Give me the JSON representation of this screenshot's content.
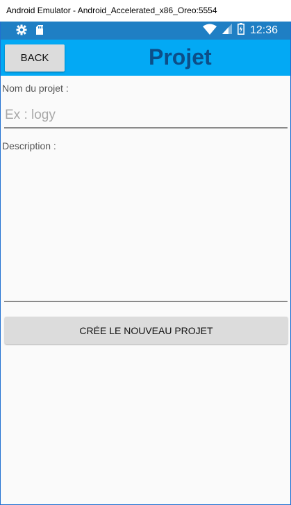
{
  "window": {
    "title": "Android Emulator - Android_Accelerated_x86_Oreo:5554"
  },
  "statusbar": {
    "time": "12:36",
    "icons_left": [
      "gear-icon",
      "sd-card-icon"
    ],
    "icons_right": [
      "wifi-icon",
      "cell-signal-icon",
      "battery-icon"
    ],
    "color": "#1f7fc4"
  },
  "appbar": {
    "back_label": "BACK",
    "title": "Projet",
    "color": "#03a9f4",
    "title_color": "#0c4e88"
  },
  "form": {
    "name_label": "Nom du projet :",
    "name_placeholder": "Ex : logy",
    "name_value": "",
    "description_label": "Description :",
    "description_value": "",
    "create_label": "CRÉE LE NOUVEAU PROJET"
  }
}
